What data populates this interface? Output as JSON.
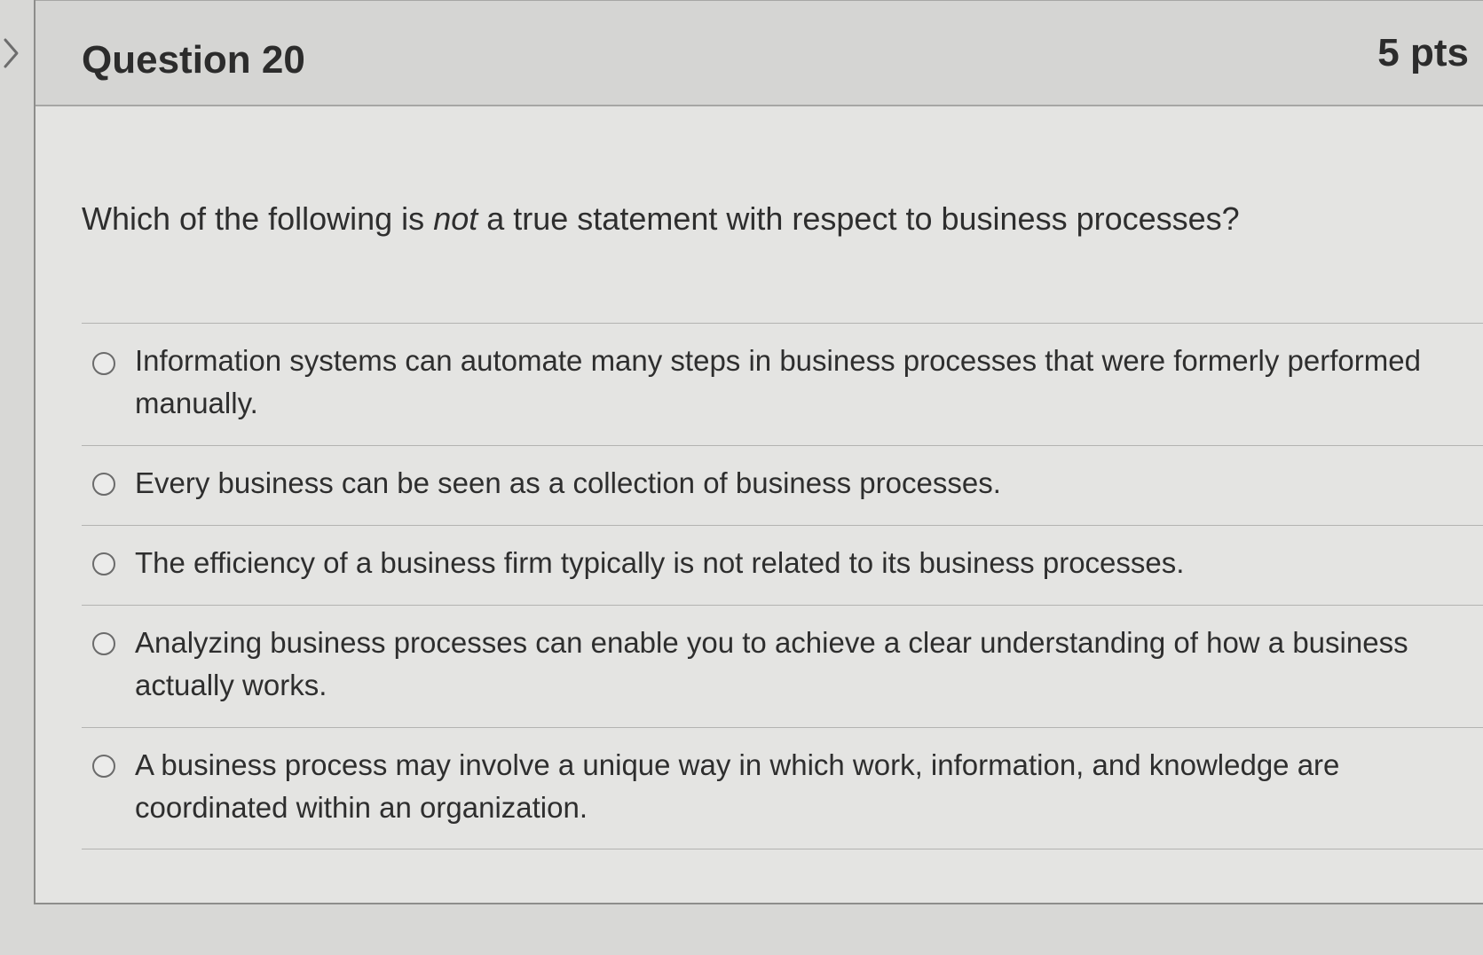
{
  "question": {
    "title": "Question 20",
    "points": "5 pts",
    "text_before": "Which of the following is ",
    "text_emphasis": "not",
    "text_after": " a true statement with respect to business processes?"
  },
  "answers": [
    {
      "label": "Information systems can automate many steps in business processes that were formerly performed manually.",
      "selected": false
    },
    {
      "label": "Every business can be seen as a collection of business processes.",
      "selected": false
    },
    {
      "label": "The efficiency of a business firm typically is not related to its business processes.",
      "selected": false
    },
    {
      "label": "Analyzing business processes can enable you to achieve a clear understanding of how a business actually works.",
      "selected": false
    },
    {
      "label": "A business process may involve a unique way in which work, information, and knowledge are coordinated within an organization.",
      "selected": false
    }
  ],
  "icons": {
    "nav_toggle": "chevron-right-icon"
  },
  "colors": {
    "background": "#d8d8d6",
    "card": "#e4e4e2",
    "header": "#d5d5d3",
    "text": "#2e2e2e",
    "divider": "#b3b3b1"
  }
}
